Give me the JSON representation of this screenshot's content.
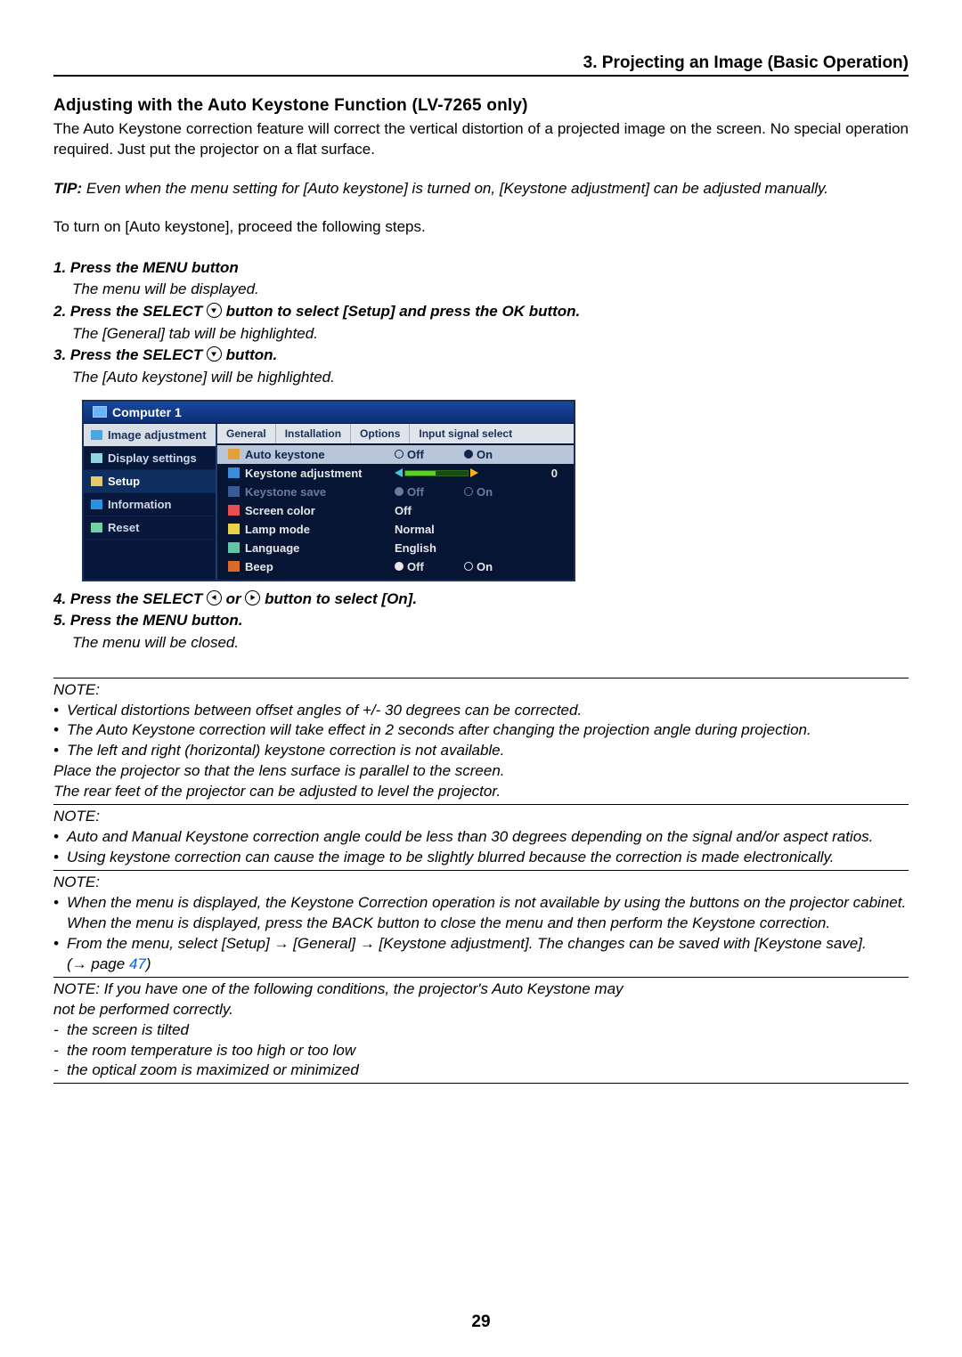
{
  "chapter": "3. Projecting an Image (Basic Operation)",
  "section_title": "Adjusting with the Auto Keystone Function (LV-7265 only)",
  "intro": "The Auto Keystone correction feature will correct the vertical distortion of a projected image on the screen. No special operation required. Just put the projector on a flat surface.",
  "tip_label": "TIP:",
  "tip_body": " Even when the menu setting for [Auto keystone] is turned on, [Keystone adjustment] can be adjusted manually.",
  "turn_on_lead": "To turn on [Auto keystone], proceed the following steps.",
  "steps": {
    "s1": "1.  Press the MENU button",
    "s1_sub": "The menu will be displayed.",
    "s2a": "2.  Press the SELECT ",
    "s2b": " button to select [Setup] and press the OK button.",
    "s2_sub": "The [General] tab will be highlighted.",
    "s3a": "3.  Press the SELECT ",
    "s3b": " button.",
    "s3_sub": "The [Auto keystone] will be highlighted.",
    "s4a": "4.  Press the SELECT ",
    "s4mid": " or ",
    "s4b": " button to select [On].",
    "s5": "5.  Press the MENU button.",
    "s5_sub": "The menu will be closed."
  },
  "osd": {
    "source": "Computer 1",
    "left_items": [
      "Image adjustment",
      "Display settings",
      "Setup",
      "Information",
      "Reset"
    ],
    "tabs": [
      "General",
      "Installation",
      "Options",
      "Input signal select"
    ],
    "rows": {
      "auto_keystone_label": "Auto keystone",
      "keystone_adj_label": "Keystone adjustment",
      "keystone_adj_value": "0",
      "keystone_save_label": "Keystone save",
      "screen_color_label": "Screen color",
      "screen_color_value": "Off",
      "lamp_mode_label": "Lamp mode",
      "lamp_mode_value": "Normal",
      "language_label": "Language",
      "language_value": "English",
      "beep_label": "Beep",
      "off": "Off",
      "on": "On"
    }
  },
  "note1_label": "NOTE:",
  "note1_bullets": [
    "Vertical distortions between offset angles of +/- 30 degrees can be corrected.",
    "The Auto Keystone correction will take effect in 2 seconds after changing the projection angle during projection.",
    "The left and right (horizontal) keystone correction is not available."
  ],
  "note1_tail1": "Place the projector so that the lens surface is parallel to the screen.",
  "note1_tail2": "The rear feet of the projector can be adjusted to level the projector.",
  "note2_label": "NOTE:",
  "note2_bullets": [
    "Auto and Manual Keystone correction angle could be less than 30 degrees depending on the signal and/or aspect ratios.",
    "Using keystone correction can cause the image to be slightly blurred because the correction is made electronically."
  ],
  "note3_label": "NOTE:",
  "note3_bullets": [
    "When the menu is displayed, the Keystone Correction operation is not available by using the buttons on the projector cabinet. When the menu is displayed, press the BACK button to close the menu and then perform the Keystone correction.",
    "From the menu, select [Setup] → [General] → [Keystone adjustment]. The changes can be saved with [Keystone save]."
  ],
  "note3_pageref_lead": "(→ page ",
  "note3_pageref": "47",
  "note3_pageref_tail": ")",
  "note4_lead": "NOTE: If you have one of the following conditions, the projector's Auto Keystone may not be performed correctly.",
  "note4_items": [
    "the screen is tilted",
    "the room temperature is too high or too low",
    "the optical zoom is maximized or minimized"
  ],
  "page_number": "29"
}
